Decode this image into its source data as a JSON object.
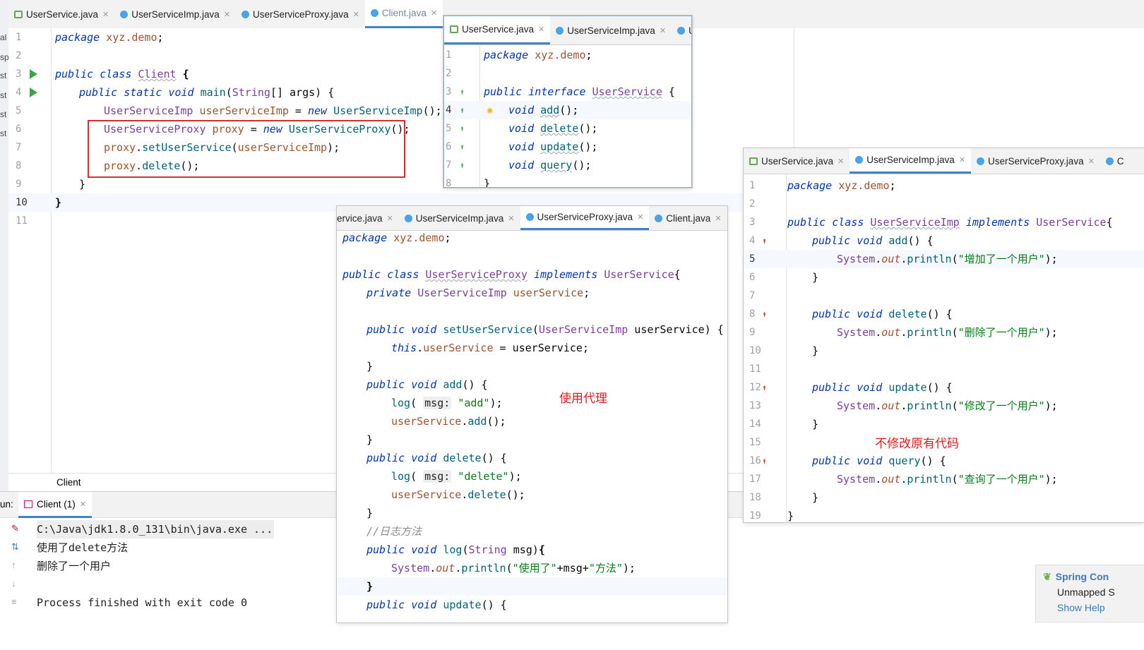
{
  "main_tabs": [
    {
      "label": "UserService.java",
      "icon": "interface-icon"
    },
    {
      "label": "UserServiceImp.java",
      "icon": "class-icon"
    },
    {
      "label": "UserServiceProxy.java",
      "icon": "class-icon"
    },
    {
      "label": "Client.java",
      "icon": "class-icon",
      "active": true
    }
  ],
  "client_code": {
    "l1": "1",
    "l2": "2",
    "l3": "3",
    "l4": "4",
    "l5": "5",
    "l6": "6",
    "l7": "7",
    "l8": "8",
    "l9": "9",
    "l10": "10",
    "l11": "11"
  },
  "breadcrumb": "Client",
  "run": {
    "label": "un:",
    "tab": "Client (1)",
    "cmd": "C:\\Java\\jdk1.8.0_131\\bin\\java.exe ...",
    "out1": "使用了delete方法",
    "out2": "删除了一个用户",
    "out3": "Process finished with exit code 0"
  },
  "popup_iface": {
    "tabs": [
      "UserService.java",
      "UserServiceImp.java",
      "Us"
    ]
  },
  "popup_proxy": {
    "tabs": [
      "ervice.java",
      "UserServiceImp.java",
      "UserServiceProxy.java",
      "Client.java"
    ]
  },
  "popup_imp": {
    "tabs": [
      "UserService.java",
      "UserServiceImp.java",
      "UserServiceProxy.java",
      "C"
    ]
  },
  "annotations": {
    "proxy_note": "使用代理",
    "imp_note": "不修改原有代码"
  },
  "spring": {
    "title": "Spring Con",
    "line1": "Unmapped S",
    "help": "Show Help"
  },
  "gutter_left": [
    "al",
    "sp",
    "st",
    "st",
    "st",
    "st"
  ]
}
